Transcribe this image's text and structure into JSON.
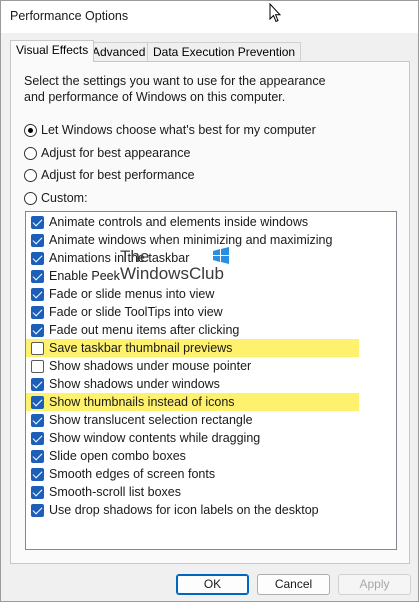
{
  "window": {
    "title": "Performance Options"
  },
  "tabs": [
    {
      "label": "Visual Effects",
      "active": true
    },
    {
      "label": "Advanced",
      "active": false
    },
    {
      "label": "Data Execution Prevention",
      "active": false
    }
  ],
  "description": "Select the settings you want to use for the appearance and performance of Windows on this computer.",
  "radios": [
    {
      "label": "Let Windows choose what's best for my computer",
      "checked": true
    },
    {
      "label": "Adjust for best appearance",
      "checked": false
    },
    {
      "label": "Adjust for best performance",
      "checked": false
    },
    {
      "label": "Custom:",
      "checked": false
    }
  ],
  "effects": [
    {
      "label": "Animate controls and elements inside windows",
      "checked": true,
      "highlighted": false
    },
    {
      "label": "Animate windows when minimizing and maximizing",
      "checked": true,
      "highlighted": false
    },
    {
      "label": "Animations in the taskbar",
      "checked": true,
      "highlighted": false
    },
    {
      "label": "Enable Peek",
      "checked": true,
      "highlighted": false
    },
    {
      "label": "Fade or slide menus into view",
      "checked": true,
      "highlighted": false
    },
    {
      "label": "Fade or slide ToolTips into view",
      "checked": true,
      "highlighted": false
    },
    {
      "label": "Fade out menu items after clicking",
      "checked": true,
      "highlighted": false
    },
    {
      "label": "Save taskbar thumbnail previews",
      "checked": false,
      "highlighted": true
    },
    {
      "label": "Show shadows under mouse pointer",
      "checked": false,
      "highlighted": false
    },
    {
      "label": "Show shadows under windows",
      "checked": true,
      "highlighted": false
    },
    {
      "label": "Show thumbnails instead of icons",
      "checked": true,
      "highlighted": true
    },
    {
      "label": "Show translucent selection rectangle",
      "checked": true,
      "highlighted": false
    },
    {
      "label": "Show window contents while dragging",
      "checked": true,
      "highlighted": false
    },
    {
      "label": "Slide open combo boxes",
      "checked": true,
      "highlighted": false
    },
    {
      "label": "Smooth edges of screen fonts",
      "checked": true,
      "highlighted": false
    },
    {
      "label": "Smooth-scroll list boxes",
      "checked": true,
      "highlighted": false
    },
    {
      "label": "Use drop shadows for icon labels on the desktop",
      "checked": true,
      "highlighted": false
    }
  ],
  "watermark": {
    "line1": "The",
    "line2": "WindowsClub"
  },
  "buttons": {
    "ok": "OK",
    "cancel": "Cancel",
    "apply": "Apply"
  },
  "colors": {
    "accent": "#1d5fb8",
    "highlight": "#fdf16e",
    "primary_border": "#0067c0"
  }
}
